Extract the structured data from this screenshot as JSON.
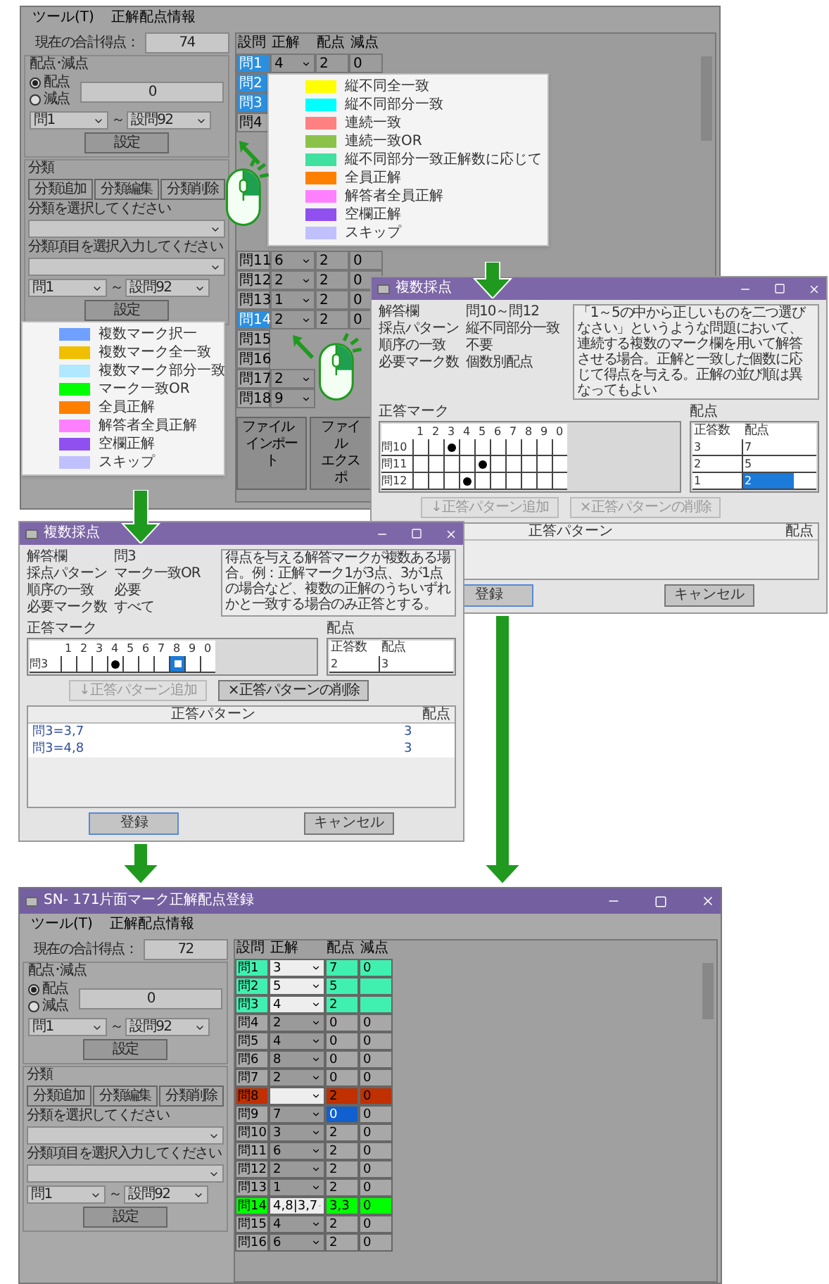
{
  "top_window": {
    "menu": [
      "ツール(T)",
      "正解配点情報"
    ],
    "panel": {
      "total_label": "現在の合計得点：",
      "total": "74",
      "points_group": "配点･減点",
      "modes": [
        {
          "label": "配点",
          "selected": true
        },
        {
          "label": "減点",
          "selected": false
        }
      ],
      "points_value": "0",
      "range": [
        "問1",
        "設問92"
      ],
      "range_sep": "～",
      "set_button": "設定",
      "category_group": "分類",
      "category_buttons": [
        "分類追加",
        "分類編集",
        "分類削除"
      ],
      "category_prompt": "分類を選択してください",
      "item_prompt": "分類項目を選択入力してください",
      "range2": [
        "問1",
        "設問92"
      ],
      "range2_sep": "～",
      "set2_button": "設定"
    },
    "table": {
      "columns": [
        "設問",
        "正解",
        "配点",
        "減点"
      ],
      "rows_above_menu": [
        {
          "label": "問1",
          "selected": true,
          "answer": "4",
          "points": "2",
          "deduction": "0"
        },
        {
          "label": "問2",
          "selected": true
        },
        {
          "label": "問3",
          "selected": true
        },
        {
          "label": "問4",
          "selected": false
        }
      ],
      "rows_below_menu": [
        {
          "label": "問11",
          "selected": false,
          "answer": "6",
          "points": "2",
          "deduction": "0"
        },
        {
          "label": "問12",
          "selected": false,
          "answer": "2",
          "points": "2",
          "deduction": "0"
        },
        {
          "label": "問13",
          "selected": false,
          "answer": "1",
          "points": "2",
          "deduction": "0"
        },
        {
          "label": "問14",
          "selected": true,
          "answer": "2",
          "points": "2",
          "deduction": "0"
        },
        {
          "label": "問15",
          "selected": false
        },
        {
          "label": "問16",
          "selected": false
        },
        {
          "label": "問17",
          "selected": false,
          "answer": "2"
        },
        {
          "label": "問18",
          "selected": false,
          "answer": "9"
        }
      ]
    },
    "import_button": [
      "ファイル",
      "インポート"
    ],
    "export_button": [
      "ファイル",
      "エクスポ"
    ]
  },
  "menu_single": {
    "items": [
      {
        "label": "縦不同全一致",
        "color": "#ffff00"
      },
      {
        "label": "縦不同部分一致",
        "color": "#00ffff"
      },
      {
        "label": "連続一致",
        "color": "#ff8080"
      },
      {
        "label": "連続一致OR",
        "color": "#8bc34a"
      },
      {
        "label": "縦不同部分一致正解数に応じて",
        "color": "#40e0a0"
      },
      {
        "label": "全員正解",
        "color": "#ff8000"
      },
      {
        "label": "解答者全員正解",
        "color": "#ff80ff"
      },
      {
        "label": "空欄正解",
        "color": "#9050f0"
      },
      {
        "label": "スキップ",
        "color": "#c0c0ff"
      }
    ]
  },
  "menu_multi": {
    "items": [
      {
        "label": "複数マーク択一",
        "color": "#6fa0ff"
      },
      {
        "label": "複数マーク全一致",
        "color": "#f0c000"
      },
      {
        "label": "複数マーク部分一致",
        "color": "#b0e8ff"
      },
      {
        "label": "マーク一致OR",
        "color": "#00ff00"
      },
      {
        "label": "全員正解",
        "color": "#ff8000"
      },
      {
        "label": "解答者全員正解",
        "color": "#ff80ff"
      },
      {
        "label": "空欄正解",
        "color": "#9050f0"
      },
      {
        "label": "スキップ",
        "color": "#c0c0ff"
      }
    ]
  },
  "dialog_partial": {
    "title": "複数採点",
    "fields": [
      {
        "label": "解答欄",
        "value": "問10～問12"
      },
      {
        "label": "採点パターン",
        "value": "縦不同部分一致"
      },
      {
        "label": "順序の一致",
        "value": "不要"
      },
      {
        "label": "必要マーク数",
        "value": "個数別配点"
      }
    ],
    "description": "「1～5の中から正しいものを二つ選びなさい」というような問題において、連続する複数のマーク欄を用いて解答させる場合。正解と一致した個数に応じて得点を与える。正解の並び順は異なってもよい",
    "marks_label": "正答マーク",
    "score_label": "配点",
    "grid": {
      "columns": [
        "1",
        "2",
        "3",
        "4",
        "5",
        "6",
        "7",
        "8",
        "9",
        "0"
      ],
      "rows": [
        {
          "label": "問10",
          "marked": [
            false,
            false,
            true,
            false,
            false,
            false,
            false,
            false,
            false,
            false
          ]
        },
        {
          "label": "問11",
          "marked": [
            false,
            false,
            false,
            false,
            true,
            false,
            false,
            false,
            false,
            false
          ]
        },
        {
          "label": "問12",
          "marked": [
            false,
            false,
            false,
            true,
            false,
            false,
            false,
            false,
            false,
            false
          ]
        }
      ]
    },
    "score_table": {
      "columns": [
        "正答数",
        "配点"
      ],
      "rows": [
        {
          "count": "3",
          "points": "7",
          "selected": false
        },
        {
          "count": "2",
          "points": "5",
          "selected": false
        },
        {
          "count": "1",
          "points": "2",
          "selected": true
        }
      ]
    },
    "add_button": {
      "label": "↓正答パターン追加",
      "disabled": true
    },
    "delete_button": {
      "label": "×正答パターンの削除",
      "disabled": true
    },
    "patterns": {
      "columns": [
        "正答パターン",
        "配点"
      ]
    },
    "ok_button": "登録",
    "cancel_button": "キャンセル"
  },
  "dialog_or": {
    "title": "複数採点",
    "fields": [
      {
        "label": "解答欄",
        "value": "問3"
      },
      {
        "label": "採点パターン",
        "value": "マーク一致OR"
      },
      {
        "label": "順序の一致",
        "value": "必要"
      },
      {
        "label": "必要マーク数",
        "value": "すべて"
      }
    ],
    "description": "得点を与える解答マークが複数ある場合。例：正解マーク1が3点、3が1点の場合など、複数の正解のうちいずれかと一致する場合のみ正答とする。",
    "marks_label": "正答マーク",
    "score_label": "配点",
    "grid": {
      "columns": [
        "1",
        "2",
        "3",
        "4",
        "5",
        "6",
        "7",
        "8",
        "9",
        "0"
      ],
      "rows": [
        {
          "label": "問3",
          "marked": [
            false,
            false,
            false,
            true,
            false,
            false,
            false,
            false,
            false,
            false
          ],
          "focused": [
            false,
            false,
            false,
            false,
            false,
            false,
            false,
            true,
            false,
            false
          ]
        }
      ]
    },
    "score_table": {
      "columns": [
        "正答数",
        "配点"
      ],
      "rows": [
        {
          "count": "2",
          "points": "3",
          "selected": false
        }
      ]
    },
    "add_button": {
      "label": "↓正答パターン追加",
      "disabled": true
    },
    "delete_button": {
      "label": "×正答パターンの削除",
      "disabled": false
    },
    "patterns": {
      "columns": [
        "正答パターン",
        "配点"
      ],
      "rows": [
        {
          "pattern": "問3=3,7",
          "points": "3"
        },
        {
          "pattern": "問3=4,8",
          "points": "3"
        }
      ]
    },
    "ok_button": "登録",
    "cancel_button": "キャンセル"
  },
  "result_window": {
    "title": "SN- 171片面マーク正解配点登録",
    "menu": [
      "ツール(T)",
      "正解配点情報"
    ],
    "panel": {
      "total_label": "現在の合計得点：",
      "total": "72",
      "points_group": "配点･減点",
      "modes": [
        {
          "label": "配点",
          "selected": true
        },
        {
          "label": "減点",
          "selected": false
        }
      ],
      "points_value": "0",
      "range": [
        "問1",
        "設問92"
      ],
      "range_sep": "～",
      "set_button": "設定",
      "category_group": "分類",
      "category_buttons": [
        "分類追加",
        "分類編集",
        "分類削除"
      ],
      "category_prompt": "分類を選択してください",
      "item_prompt": "分類項目を選択入力してください",
      "range2": [
        "問1",
        "設問92"
      ],
      "range2_sep": "～",
      "set2_button": "設定"
    },
    "table": {
      "columns": [
        "設問",
        "正解",
        "配点",
        "減点"
      ],
      "rows": [
        {
          "label": "問1",
          "answer": "3",
          "points": "7",
          "deduction": "0",
          "color": "#40f0b0",
          "score_selected": false
        },
        {
          "label": "問2",
          "answer": "5",
          "points": "5",
          "color": "#40f0b0",
          "score_selected": false
        },
        {
          "label": "問3",
          "answer": "4",
          "points": "2",
          "color": "#40f0b0",
          "score_selected": false
        },
        {
          "label": "問4",
          "answer": "2",
          "points": "0",
          "deduction": "0",
          "score_selected": false
        },
        {
          "label": "問5",
          "answer": "4",
          "points": "0",
          "deduction": "0",
          "score_selected": false
        },
        {
          "label": "問6",
          "answer": "8",
          "points": "0",
          "deduction": "0",
          "score_selected": false
        },
        {
          "label": "問7",
          "answer": "2",
          "points": "0",
          "deduction": "0",
          "score_selected": false
        },
        {
          "label": "問8",
          "points": "2",
          "deduction": "0",
          "color": "#c03000",
          "score_selected": false
        },
        {
          "label": "問9",
          "answer": "7",
          "points": "0",
          "deduction": "0",
          "score_selected": true
        },
        {
          "label": "問10",
          "answer": "3",
          "points": "2",
          "deduction": "0",
          "score_selected": false
        },
        {
          "label": "問11",
          "answer": "6",
          "points": "2",
          "deduction": "0",
          "score_selected": false
        },
        {
          "label": "問12",
          "answer": "2",
          "points": "2",
          "deduction": "0",
          "score_selected": false
        },
        {
          "label": "問13",
          "answer": "1",
          "points": "2",
          "deduction": "0",
          "score_selected": false
        },
        {
          "label": "問14",
          "answer": "4,8|3,7",
          "points": "3,3",
          "deduction": "0",
          "color": "#00ff00",
          "score_selected": false
        },
        {
          "label": "問15",
          "answer": "4",
          "points": "2",
          "deduction": "0",
          "score_selected": false
        },
        {
          "label": "問16",
          "answer": "6",
          "points": "2",
          "deduction": "0",
          "score_selected": false
        }
      ]
    }
  }
}
